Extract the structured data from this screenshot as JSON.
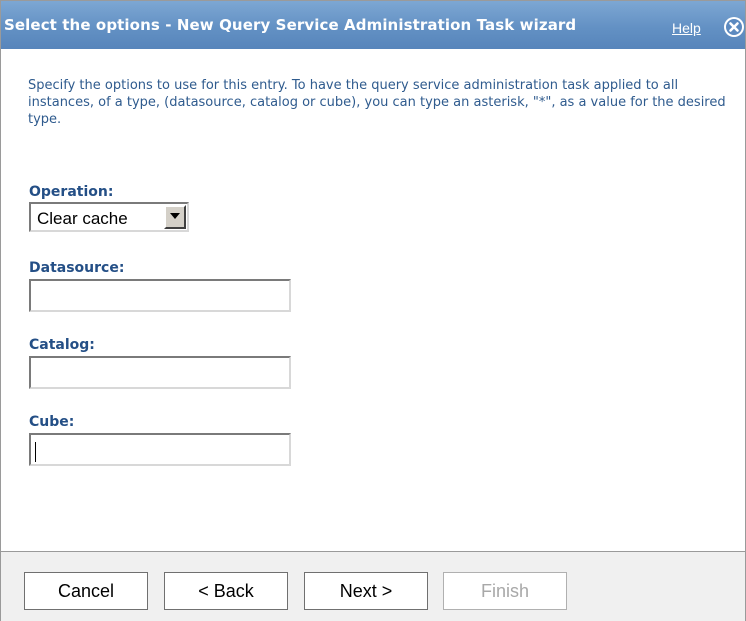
{
  "dialog": {
    "title": "Select the options - New Query Service Administration Task wizard",
    "help_label": "Help",
    "close_icon": "close-icon"
  },
  "intro_text": "Specify the options to use for this entry. To have the query service administration task applied to all instances, of a type, (datasource, catalog or cube), you can type an asterisk, \"*\", as a value for the desired type.",
  "fields": {
    "operation": {
      "label": "Operation:",
      "selected": "Clear cache"
    },
    "datasource": {
      "label": "Datasource:",
      "value": ""
    },
    "catalog": {
      "label": "Catalog:",
      "value": ""
    },
    "cube": {
      "label": "Cube:",
      "value": ""
    }
  },
  "buttons": {
    "cancel": "Cancel",
    "back": "< Back",
    "next": "Next >",
    "finish": "Finish"
  },
  "colors": {
    "title_bar": "#6391c4",
    "label_text": "#244f86",
    "intro_text": "#2f5b8e"
  }
}
